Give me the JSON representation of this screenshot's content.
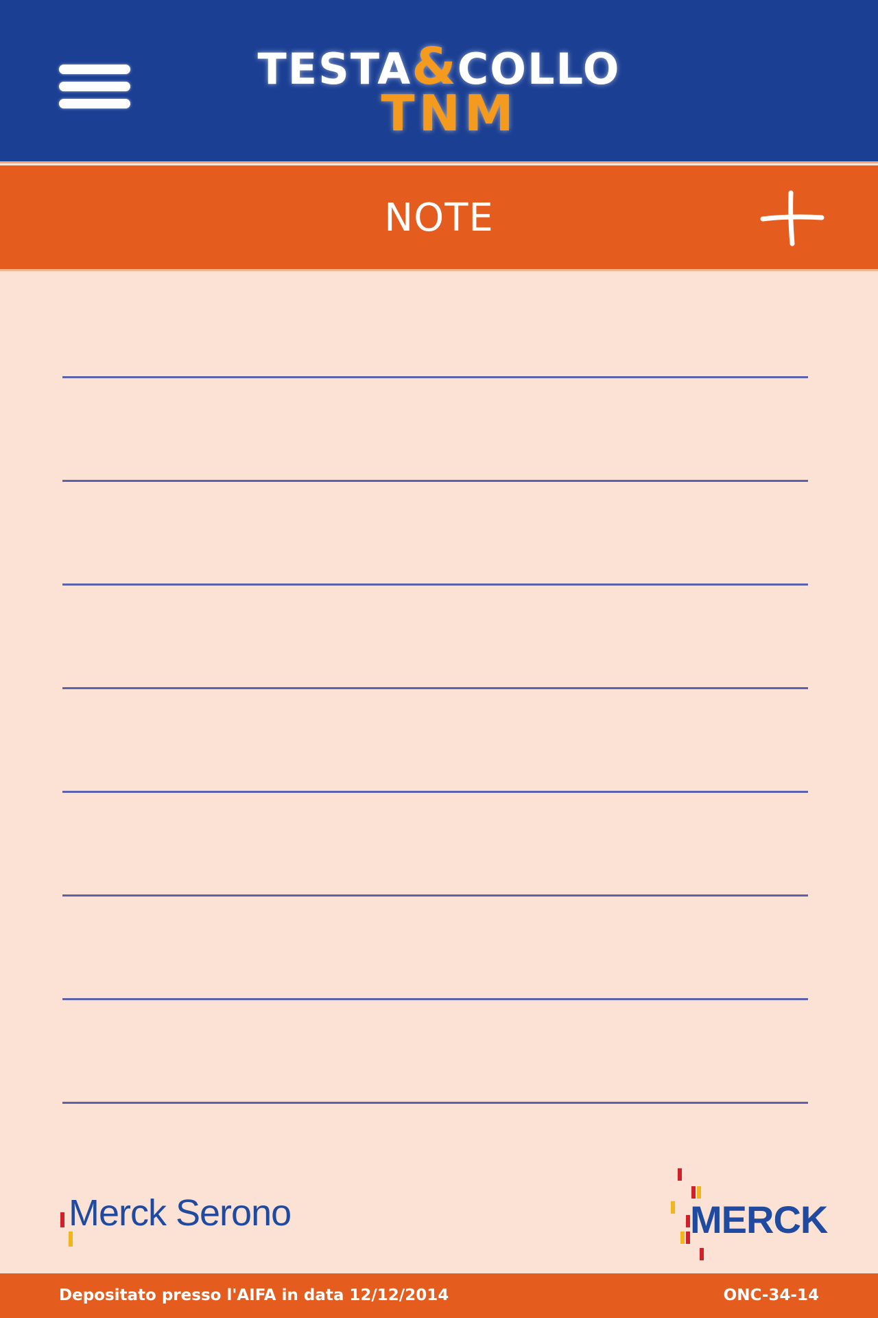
{
  "header": {
    "menu_icon": "hamburger-menu-icon",
    "logo": {
      "part1": "TESTA",
      "ampersand": "&",
      "part2": "COLLO",
      "line2": "TNM"
    },
    "background": "#1b3f93",
    "accent": "#f39a1f"
  },
  "titlebar": {
    "title": "NOTE",
    "add_icon": "plus-icon",
    "background": "#e55c1f"
  },
  "notes": {
    "line_count": 8,
    "line_color": "#5a62b0",
    "background": "#fbe2d5"
  },
  "logos": {
    "left": "Merck Serono",
    "right": "MERCK"
  },
  "footer": {
    "deposit_text": "Depositato presso l'AIFA in data 12/12/2014",
    "code": "ONC-34-14"
  }
}
